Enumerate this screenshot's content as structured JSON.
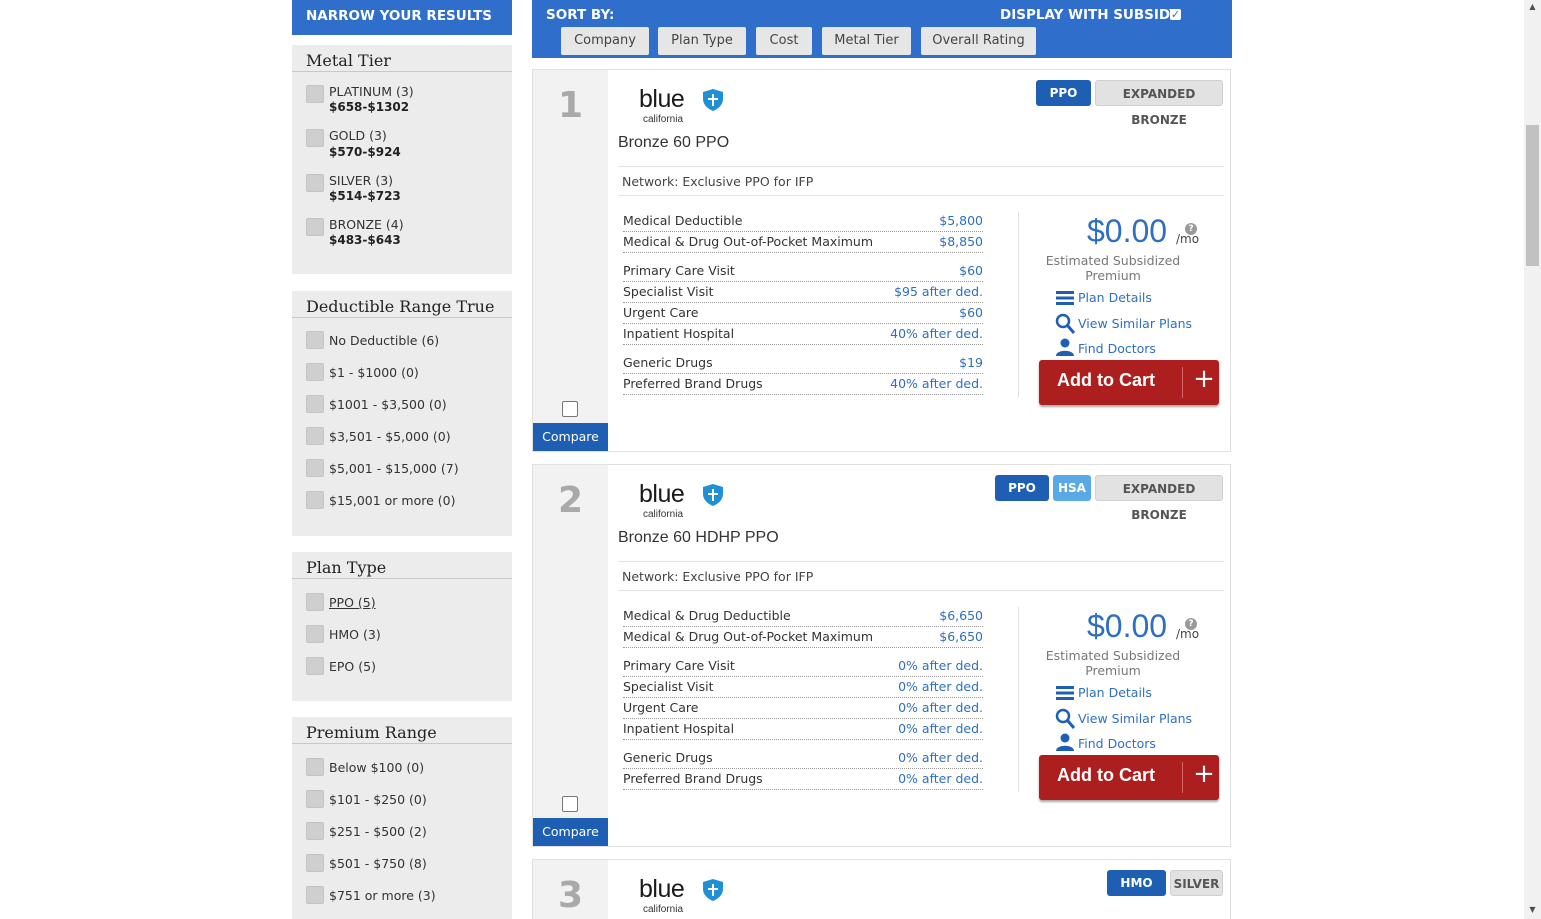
{
  "sidebar": {
    "header": "NARROW YOUR RESULTS",
    "metal_tier": {
      "title": "Metal Tier",
      "items": [
        {
          "label": "PLATINUM (3)",
          "range": "$658-$1302"
        },
        {
          "label": "GOLD (3)",
          "range": "$570-$924"
        },
        {
          "label": "SILVER (3)",
          "range": "$514-$723"
        },
        {
          "label": "BRONZE (4)",
          "range": "$483-$643"
        }
      ]
    },
    "deductible": {
      "title": "Deductible Range True",
      "items": [
        "No Deductible (6)",
        "$1 - $1000 (0)",
        "$1001 - $3,500 (0)",
        "$3,501 - $5,000 (0)",
        "$5,001 - $15,000 (7)",
        "$15,001 or more (0)"
      ]
    },
    "plan_type": {
      "title": "Plan Type",
      "items": [
        "PPO (5)",
        "HMO (3)",
        "EPO (5)"
      ]
    },
    "premium": {
      "title": "Premium Range",
      "items": [
        "Below $100 (0)",
        "$101 - $250 (0)",
        "$251 - $500 (2)",
        "$501 - $750 (8)",
        "$751 or more (3)"
      ]
    }
  },
  "sortbar": {
    "label": "SORT BY:",
    "subsidy_label": "DISPLAY WITH SUBSIDY",
    "subsidy_checked": true,
    "buttons": [
      "Company",
      "Plan Type",
      "Cost",
      "Metal Tier",
      "Overall Rating"
    ]
  },
  "common": {
    "compare_label": "Compare",
    "price_unit": "/mo",
    "price_caption": "Estimated Subsidized Premium",
    "plan_details": "Plan Details",
    "view_similar": "View Similar Plans",
    "find_doctors": "Find Doctors",
    "add_to_cart": "Add to Cart",
    "logo_main": "blue",
    "logo_sub": "california"
  },
  "plans": [
    {
      "rank": "1",
      "name": "Bronze 60 PPO",
      "network": "Network: Exclusive PPO for IFP",
      "badges": [
        "PPO",
        "EXPANDED BRONZE"
      ],
      "price": "$0.00",
      "benefits": [
        {
          "label": "Medical Deductible",
          "value": "$5,800"
        },
        {
          "label": "Medical & Drug Out-of-Pocket Maximum",
          "value": "$8,850"
        },
        {
          "label": "Primary Care Visit",
          "value": "$60"
        },
        {
          "label": "Specialist Visit",
          "value": "$95 after ded."
        },
        {
          "label": "Urgent Care",
          "value": "$60"
        },
        {
          "label": "Inpatient Hospital",
          "value": "40% after ded."
        },
        {
          "label": "Generic Drugs",
          "value": "$19"
        },
        {
          "label": "Preferred Brand Drugs",
          "value": "40% after ded."
        }
      ]
    },
    {
      "rank": "2",
      "name": "Bronze 60 HDHP PPO",
      "network": "Network: Exclusive PPO for IFP",
      "badges": [
        "PPO",
        "HSA",
        "EXPANDED BRONZE"
      ],
      "price": "$0.00",
      "benefits": [
        {
          "label": "Medical & Drug Deductible",
          "value": "$6,650"
        },
        {
          "label": "Medical & Drug Out-of-Pocket Maximum",
          "value": "$6,650"
        },
        {
          "label": "Primary Care Visit",
          "value": "0% after ded."
        },
        {
          "label": "Specialist Visit",
          "value": "0% after ded."
        },
        {
          "label": "Urgent Care",
          "value": "0% after ded."
        },
        {
          "label": "Inpatient Hospital",
          "value": "0% after ded."
        },
        {
          "label": "Generic Drugs",
          "value": "0% after ded."
        },
        {
          "label": "Preferred Brand Drugs",
          "value": "0% after ded."
        }
      ]
    },
    {
      "rank": "3",
      "badges": [
        "HMO",
        "SILVER"
      ]
    }
  ],
  "colors": {
    "brand_blue": "#2f6ecb",
    "cart_red": "#ad1f1f",
    "link_blue": "#2e6fc1"
  }
}
